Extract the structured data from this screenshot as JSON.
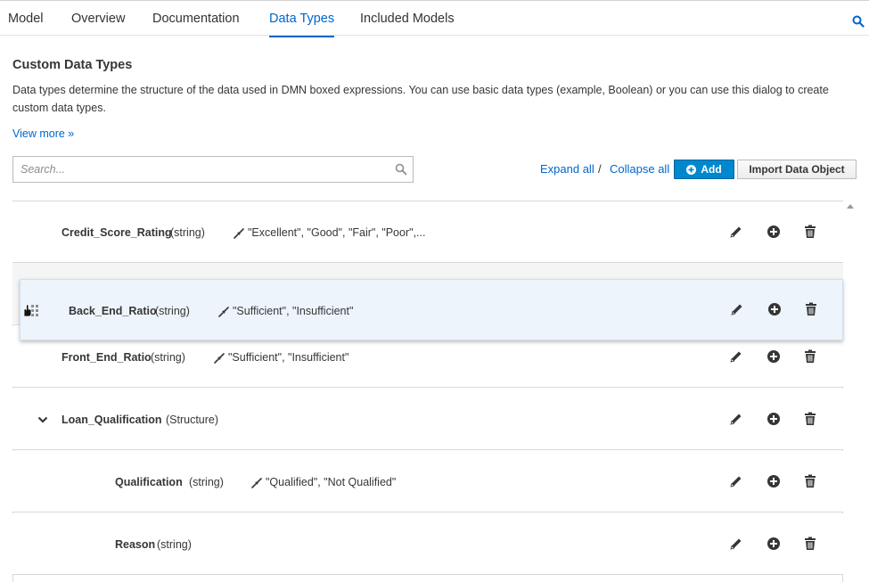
{
  "tabs": [
    {
      "label": "Model"
    },
    {
      "label": "Overview"
    },
    {
      "label": "Documentation"
    },
    {
      "label": "Data Types",
      "active": true
    },
    {
      "label": "Included Models"
    }
  ],
  "section": {
    "title": "Custom Data Types",
    "description": "Data types determine the structure of the data used in DMN boxed expressions. You can use basic data types (example, Boolean) or you can use this dialog to create custom data types.",
    "view_more": "View more »"
  },
  "search": {
    "placeholder": "Search...",
    "value": ""
  },
  "toolbar": {
    "expand_all": "Expand all",
    "separator": "/",
    "collapse_all": "Collapse all",
    "add_label": "Add",
    "import_label": "Import Data Object"
  },
  "rows": [
    {
      "name": "Credit_Score_Rating",
      "type": "(string)",
      "constraint": "\"Excellent\", \"Good\", \"Fair\", \"Poor\",..."
    },
    {
      "name": "Back_End_Ratio",
      "type": "(string)",
      "constraint": "\"Sufficient\", \"Insufficient\"",
      "state": "dragging"
    },
    {
      "name": "Front_End_Ratio",
      "type": "(string)",
      "constraint": "\"Sufficient\", \"Insufficient\""
    },
    {
      "name": "Loan_Qualification",
      "type": "(Structure)",
      "constraint": "",
      "expanded": true
    },
    {
      "name": "Qualification",
      "type": "(string)",
      "constraint": "\"Qualified\", \"Not Qualified\"",
      "nested": true
    },
    {
      "name": "Reason",
      "type": "(string)",
      "constraint": "",
      "nested": true
    }
  ],
  "icons": {
    "edit": "pencil-icon",
    "add_nested": "plus-circle-icon",
    "delete": "trash-icon",
    "constraint": "constraint-icon",
    "search": "search-icon",
    "drag": "drag-handle-icon"
  },
  "colors": {
    "accent": "#0066cc",
    "add_button": "#0088ce",
    "drag_row": "#edf4fb"
  }
}
